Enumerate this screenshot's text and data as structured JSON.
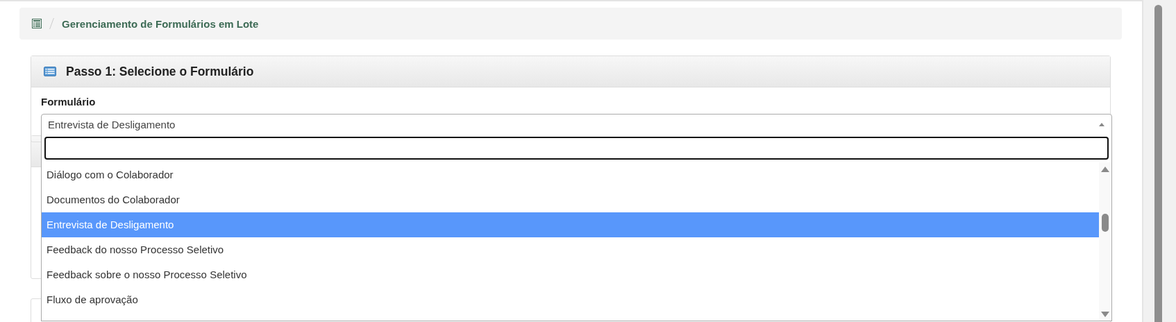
{
  "breadcrumb": {
    "current": "Gerenciamento de Formulários em Lote"
  },
  "step_card": {
    "title": "Passo 1: Selecione o Formulário",
    "field_label": "Formulário",
    "select": {
      "value": "Entrevista de Desligamento",
      "expanded": true,
      "options": [
        {
          "label": "Diálogo com o Colaborador",
          "selected": false
        },
        {
          "label": "Documentos do Colaborador",
          "selected": false
        },
        {
          "label": "Entrevista de Desligamento",
          "selected": true
        },
        {
          "label": "Feedback do nosso Processo Seletivo",
          "selected": false
        },
        {
          "label": "Feedback sobre o nosso Processo Seletivo",
          "selected": false
        },
        {
          "label": "Fluxo de aprovação",
          "selected": false
        }
      ]
    }
  }
}
